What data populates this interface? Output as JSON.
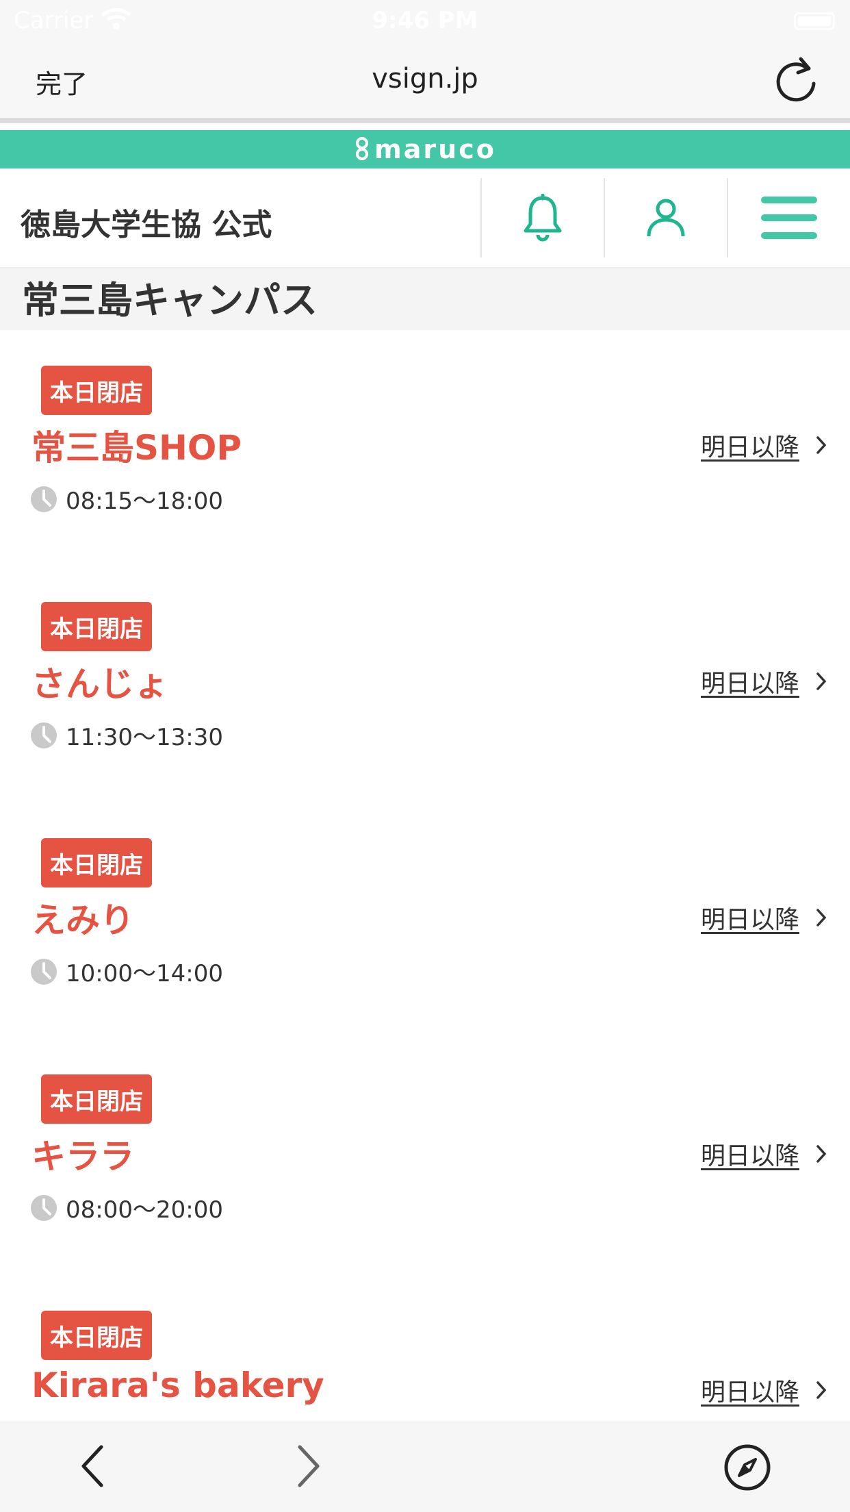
{
  "status_bar": {
    "carrier": "Carrier",
    "time": "9:46 PM"
  },
  "browser": {
    "done_label": "完了",
    "url": "vsign.jp"
  },
  "brand": {
    "name": "maruco",
    "color": "#44c7a7"
  },
  "header": {
    "title": "徳島大学生協 公式",
    "icons": [
      "bell-icon",
      "user-icon",
      "menu-icon"
    ]
  },
  "section": {
    "title": "常三島キャンパス"
  },
  "shops": [
    {
      "badge": "本日閉店",
      "name": "常三島SHOP",
      "hours": "08:15〜18:00",
      "link": "明日以降"
    },
    {
      "badge": "本日閉店",
      "name": "さんじょ",
      "hours": "11:30〜13:30",
      "link": "明日以降"
    },
    {
      "badge": "本日閉店",
      "name": "えみり",
      "hours": "10:00〜14:00",
      "link": "明日以降"
    },
    {
      "badge": "本日閉店",
      "name": "キララ",
      "hours": "08:00〜20:00",
      "link": "明日以降"
    },
    {
      "badge": "本日閉店",
      "name": "Kirara's bakery",
      "hours": "",
      "link": "明日以降"
    }
  ],
  "colors": {
    "accent": "#44c7a7",
    "closed": "#e55442",
    "icon_green": "#1fb58f"
  }
}
